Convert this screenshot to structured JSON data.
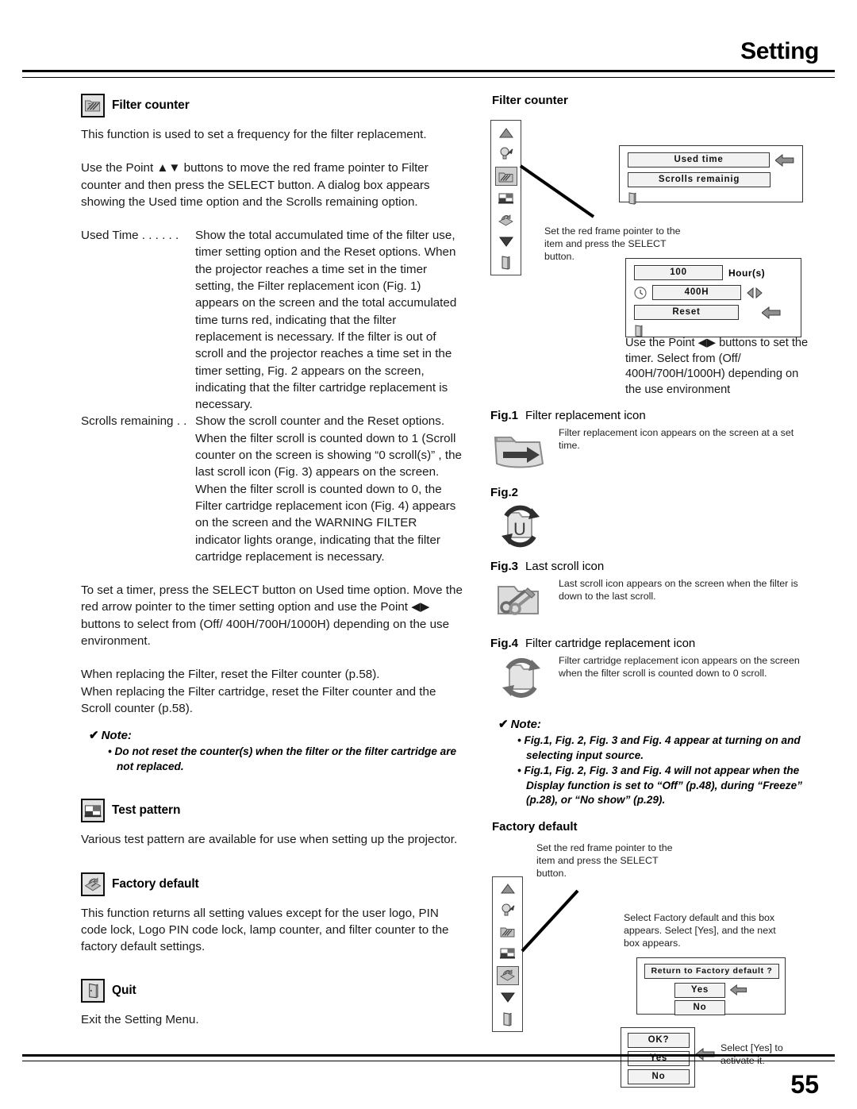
{
  "header": {
    "title": "Setting",
    "page_number": "55"
  },
  "left": {
    "filter_counter": {
      "heading": "Filter counter",
      "icon": "filter-counter-icon",
      "p1": "This function is used to set a frequency for the filter replacement.",
      "p2": "Use the Point ▲▼ buttons to move the red frame pointer to Filter counter and then press the SELECT button. A dialog box appears showing the Used time option and the Scrolls remaining option.",
      "definitions": [
        {
          "term": "Used Time . . . . . .",
          "desc": "Show the total accumulated time of the filter use, timer setting option and the Reset options. When the projector reaches a time set in the timer setting, the Filter replacement icon (Fig. 1) appears on the screen and the total accumulated time turns red, indicating that the filter replacement is necessary. If the filter is out of scroll and the projector reaches a time set in the timer setting, Fig. 2 appears on the screen, indicating that the filter cartridge replacement is necessary."
        },
        {
          "term": "Scrolls remaining . .",
          "desc": "Show the scroll counter and the Reset options. When the filter scroll is counted down to 1 (Scroll counter on the screen is showing “0 scroll(s)” , the last scroll icon (Fig. 3) appears on the screen. When the filter scroll is counted down to 0, the Filter cartridge replacement icon (Fig. 4) appears on the screen and the WARNING FILTER indicator lights orange, indicating that the filter cartridge replacement is necessary."
        }
      ],
      "p3": "To set a timer, press the SELECT button on Used time option. Move the red arrow pointer to the timer setting option and use the Point ◀▶ buttons to select from (Off/ 400H/700H/1000H) depending on the use environment.",
      "p4_line1": "When replacing the Filter, reset the Filter counter (p.58).",
      "p4_line2": "When replacing the Filter cartridge, reset the Filter counter and the Scroll counter (p.58).",
      "note_head": "Note:",
      "note_items": [
        "Do not reset the counter(s) when the filter or the filter cartridge are not replaced."
      ]
    },
    "test_pattern": {
      "heading": "Test pattern",
      "icon": "test-pattern-icon",
      "p1": "Various test pattern are available for use when setting up the projector."
    },
    "factory_default": {
      "heading": "Factory default",
      "icon": "factory-default-icon",
      "p1": "This function returns all setting values except for the user logo, PIN code lock, Logo PIN code lock, lamp counter, and filter counter to the factory default settings."
    },
    "quit": {
      "heading": "Quit",
      "icon": "quit-icon",
      "p1": "Exit the Setting Menu."
    }
  },
  "right": {
    "filter_counter_panel": {
      "heading": "Filter counter",
      "menu_items": [
        "up-arrow-icon",
        "lamp-control-icon",
        "filter-counter-icon",
        "test-pattern-icon",
        "factory-default-icon",
        "down-arrow-icon",
        "quit-icon"
      ],
      "dialog1": {
        "items": [
          "Used time",
          "Scrolls remainig"
        ],
        "quit_icon": "quit-icon"
      },
      "callout1": "Set the red frame pointer to the item and press the SELECT button.",
      "dialog2": {
        "hours_value": "100",
        "hours_label": "Hour(s)",
        "timer_value": "400H",
        "reset_label": "Reset",
        "clock_icon": "clock-icon",
        "lr-adjust_icon": "left-right-adjust-icon",
        "quit_icon": "quit-icon"
      },
      "callout2": "Use the Point ◀▶ buttons to set the timer. Select from (Off/ 400H/700H/1000H) depending on the use environment"
    },
    "figures": [
      {
        "label": "Fig.1",
        "title": "Filter replacement icon",
        "icon": "filter-replacement-icon",
        "caption": "Filter replacement icon appears on the screen at a set time."
      },
      {
        "label": "Fig.2",
        "title": "",
        "icon": "filter-cartridge-u-icon",
        "caption": ""
      },
      {
        "label": "Fig.3",
        "title": "Last scroll icon",
        "icon": "last-scroll-icon",
        "caption": "Last scroll icon appears on the screen when the filter is down to the last scroll."
      },
      {
        "label": "Fig.4",
        "title": "Filter cartridge replacement icon",
        "icon": "filter-cartridge-replacement-icon",
        "caption": "Filter cartridge replacement icon appears on the screen when the filter scroll is counted down to 0 scroll."
      }
    ],
    "note_head": "Note:",
    "note_items": [
      "Fig.1, Fig. 2, Fig. 3 and Fig. 4 appear at turning on and selecting input source.",
      "Fig.1, Fig. 2, Fig. 3 and Fig. 4 will not appear when the Display function is set to “Off” (p.48), during “Freeze” (p.28), or “No show” (p.29)."
    ],
    "factory_default_panel": {
      "heading": "Factory default",
      "callout1": "Set the red frame pointer to the item and press the SELECT button.",
      "callout2": "Select Factory default and this box appears. Select [Yes], and the next box appears.",
      "menu_items": [
        "up-arrow-icon",
        "lamp-control-icon",
        "filter-counter-icon",
        "test-pattern-icon",
        "factory-default-icon",
        "down-arrow-icon",
        "quit-icon"
      ],
      "dialog_confirm": {
        "question": "Return to Factory default ?",
        "yes": "Yes",
        "no": "No"
      },
      "dialog_ok": {
        "question": "OK?",
        "yes": "Yes",
        "no": "No"
      },
      "callout3": "Select [Yes] to activate it."
    }
  },
  "colors": {
    "ink": "#000000",
    "body_text": "#1a1a1a",
    "osd_face": "#f2f2f2",
    "osd_border": "#333333",
    "icon_fill": "#d7d7d7"
  }
}
